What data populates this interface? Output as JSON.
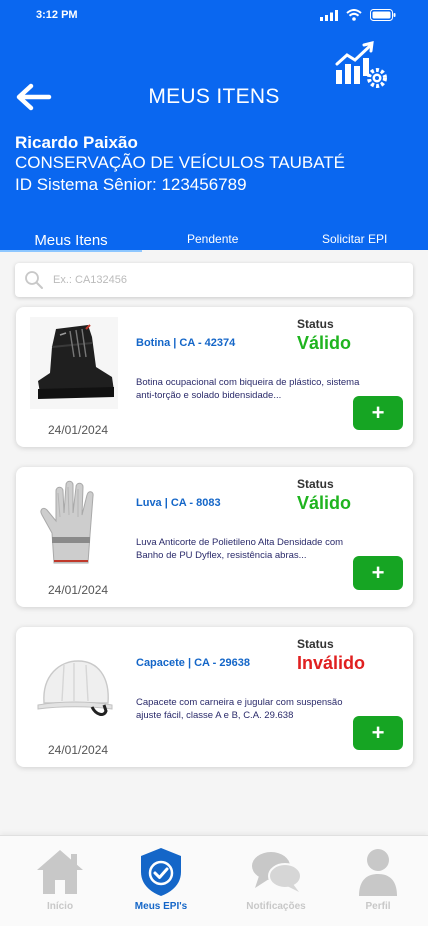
{
  "status_bar": {
    "time": "3:12 PM"
  },
  "header": {
    "title": "MEUS ITENS"
  },
  "user": {
    "name": "Ricardo Paixão",
    "department": "CONSERVAÇÃO DE VEÍCULOS TAUBATÉ",
    "system_id": "ID Sistema Sênior: 123456789"
  },
  "tabs": [
    {
      "label": "Meus Itens",
      "active": true
    },
    {
      "label": "Pendente"
    },
    {
      "label": "Solicitar EPI"
    }
  ],
  "search": {
    "placeholder": "Ex.: CA132456",
    "value": ""
  },
  "items": [
    {
      "name": "Botina | CA - 42374",
      "status_label": "Status",
      "status": "Válido",
      "description": "Botina ocupacional com biqueira de plástico, sistema anti-torção e solado bidensidade...",
      "date": "24/01/2024",
      "add_label": "+",
      "icon": "boot-icon"
    },
    {
      "name": "Luva | CA - 8083",
      "status_label": "Status",
      "status": "Válido",
      "description": "Luva Anticorte de Polietileno Alta Densidade com Banho de PU Dyflex, resistência abras...",
      "date": "24/01/2024",
      "add_label": "+",
      "icon": "glove-icon"
    },
    {
      "name": "Capacete | CA - 29638",
      "status_label": "Status",
      "status": "Inválido",
      "description": "Capacete com carneira e jugular com  suspensão ajuste fácil, classe A e B, C.A. 29.638",
      "date": "24/01/2024",
      "add_label": "+",
      "icon": "helmet-icon"
    }
  ],
  "bottom_nav": [
    {
      "label": "Início",
      "icon": "home-icon"
    },
    {
      "label": "Meus EPI's",
      "icon": "shield-check-icon",
      "active": true
    },
    {
      "label": "Notificações",
      "icon": "chat-bubbles-icon"
    },
    {
      "label": "Perfil",
      "icon": "person-icon"
    }
  ],
  "colors": {
    "header_bg": "#0a67f0",
    "valid": "#1fb41f",
    "invalid": "#e02020",
    "add_button": "#16a523",
    "link_blue": "#1466c8"
  }
}
